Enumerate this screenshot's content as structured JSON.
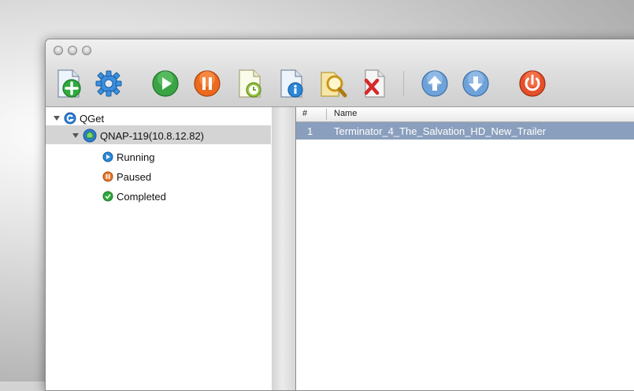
{
  "toolbar": {
    "buttons": [
      {
        "name": "add-task",
        "icon": "document-plus-icon"
      },
      {
        "name": "settings",
        "icon": "gear-icon"
      },
      {
        "name": "start",
        "icon": "play-icon"
      },
      {
        "name": "pause",
        "icon": "pause-icon"
      },
      {
        "name": "schedule",
        "icon": "document-clock-icon"
      },
      {
        "name": "info",
        "icon": "document-info-icon"
      },
      {
        "name": "search",
        "icon": "magnifier-icon"
      },
      {
        "name": "remove",
        "icon": "document-delete-icon"
      },
      {
        "name": "move-up",
        "icon": "arrow-up-icon"
      },
      {
        "name": "move-down",
        "icon": "arrow-down-icon"
      },
      {
        "name": "shutdown",
        "icon": "power-icon"
      }
    ]
  },
  "sidebar": {
    "root": {
      "label": "QGet"
    },
    "server": {
      "label": "QNAP-119(10.8.12.82)"
    },
    "items": [
      {
        "label": "Running",
        "color": "#2b8ad8"
      },
      {
        "label": "Paused",
        "color": "#e8782a"
      },
      {
        "label": "Completed",
        "color": "#2faa3a"
      }
    ]
  },
  "table": {
    "columns": [
      "#",
      "Name"
    ],
    "rows": [
      {
        "num": "1",
        "name": "Terminator_4_The_Salvation_HD_New_Trailer"
      }
    ]
  },
  "colors": {
    "selection": "#8a9fbd",
    "sidebar_selection": "#d4d4d4"
  }
}
